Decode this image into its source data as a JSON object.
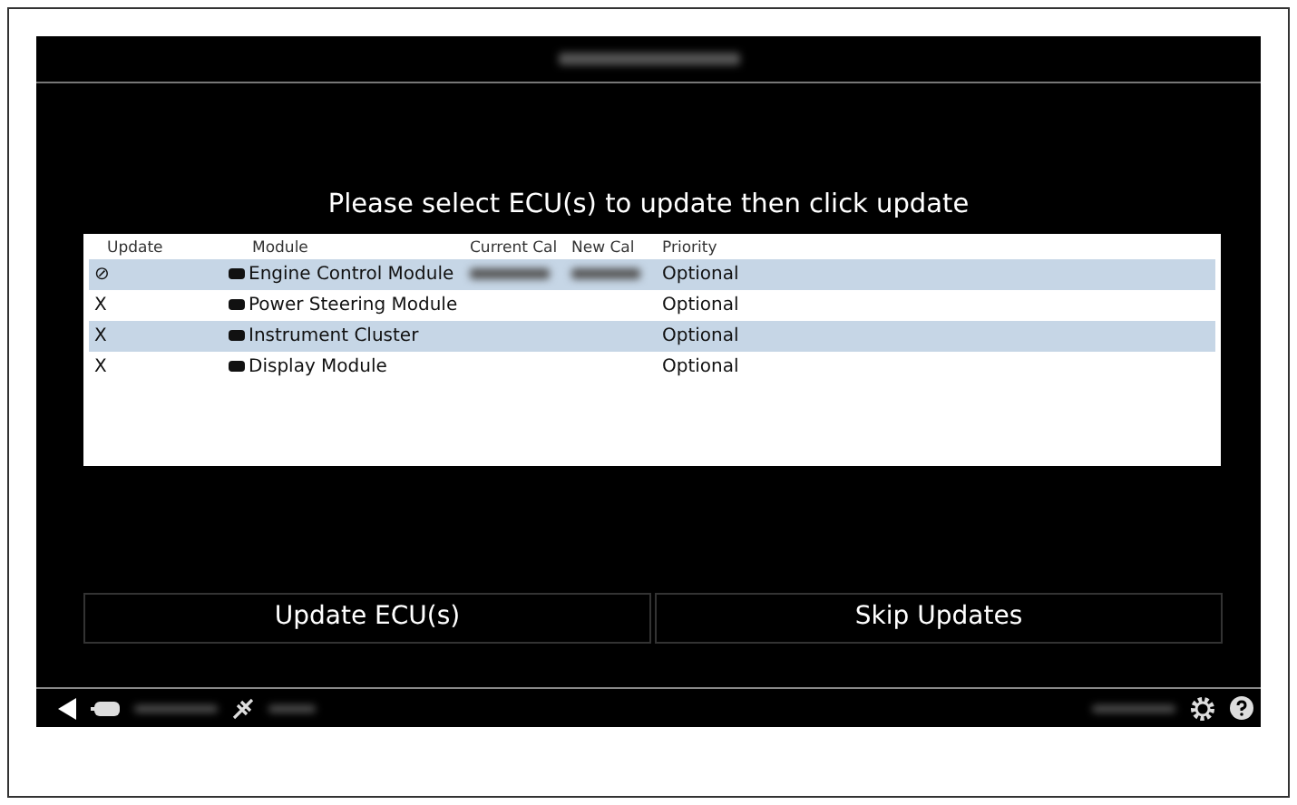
{
  "heading": "Please select ECU(s) to update then click update",
  "table": {
    "columns": [
      "Update",
      "Module",
      "Current Cal",
      "New Cal",
      "Priority"
    ],
    "rows": [
      {
        "update": "⊘",
        "module": "Engine Control Module",
        "priority": "Optional"
      },
      {
        "update": "X",
        "module": "Power Steering Module",
        "priority": "Optional"
      },
      {
        "update": "X",
        "module": "Instrument Cluster",
        "priority": "Optional"
      },
      {
        "update": "X",
        "module": "Display Module",
        "priority": "Optional"
      }
    ]
  },
  "buttons": [
    "Update ECU(s)",
    "Skip Updates"
  ]
}
